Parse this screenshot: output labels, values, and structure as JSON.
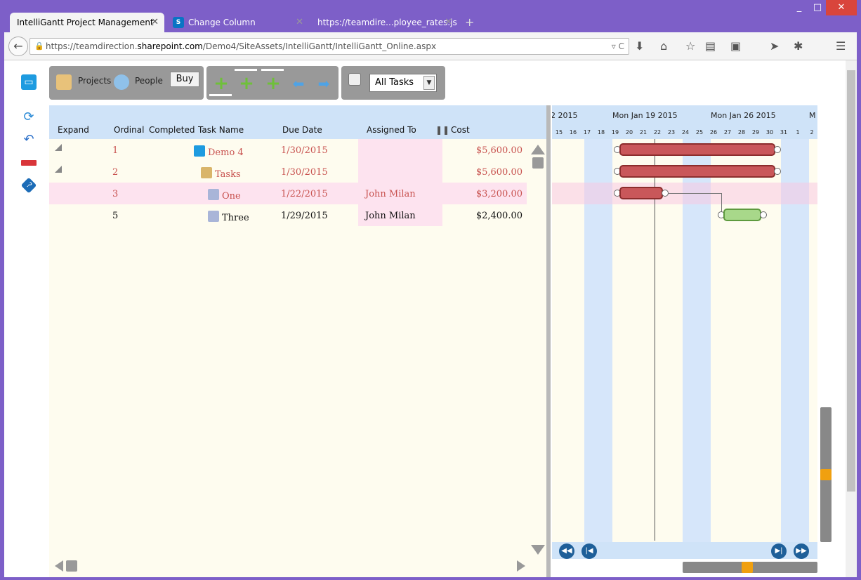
{
  "browser": {
    "tabs": [
      {
        "title": "IntelliGantt Project Management"
      },
      {
        "title": "Change Column"
      },
      {
        "title": "https://teamdire...ployee_rates.js"
      }
    ],
    "new_tab": "+",
    "url_prefix": "https://teamdirection.",
    "url_domain": "sharepoint.com",
    "url_path": "/Demo4/SiteAssets/IntelliGantt/IntelliGantt_Online.aspx"
  },
  "toolbar": {
    "projects_label": "Projects",
    "people_label": "People",
    "buy_label": "Buy",
    "filter_value": "All Tasks"
  },
  "grid": {
    "columns": [
      "Expand",
      "Ordinal",
      "Completed",
      "Task Name",
      "Due Date",
      "Assigned To",
      "Cost"
    ],
    "rows": [
      {
        "ordinal": "1",
        "name": "Demo 4",
        "due": "1/30/2015",
        "assigned": "",
        "cost": "$5,600.00"
      },
      {
        "ordinal": "2",
        "name": "Tasks",
        "due": "1/30/2015",
        "assigned": "",
        "cost": "$5,600.00"
      },
      {
        "ordinal": "3",
        "name": "One",
        "due": "1/22/2015",
        "assigned": "John Milan",
        "cost": "$3,200.00"
      },
      {
        "ordinal": "5",
        "name": "Three",
        "due": "1/29/2015",
        "assigned": "John Milan",
        "cost": "$2,400.00"
      }
    ]
  },
  "gantt": {
    "weeks": [
      "2 2015",
      "Mon Jan 19 2015",
      "Mon Jan 26 2015",
      "M"
    ],
    "days": [
      "15",
      "16",
      "17",
      "18",
      "19",
      "20",
      "21",
      "22",
      "23",
      "24",
      "25",
      "26",
      "27",
      "28",
      "29",
      "30",
      "31",
      "1",
      "2"
    ]
  },
  "colors": {
    "task_bar": "#c9575a",
    "done_bar": "#a8d88a",
    "weekend": "#d6e6fa",
    "grid_bg": "#fefcef",
    "header_bg": "#cfe3f8"
  }
}
